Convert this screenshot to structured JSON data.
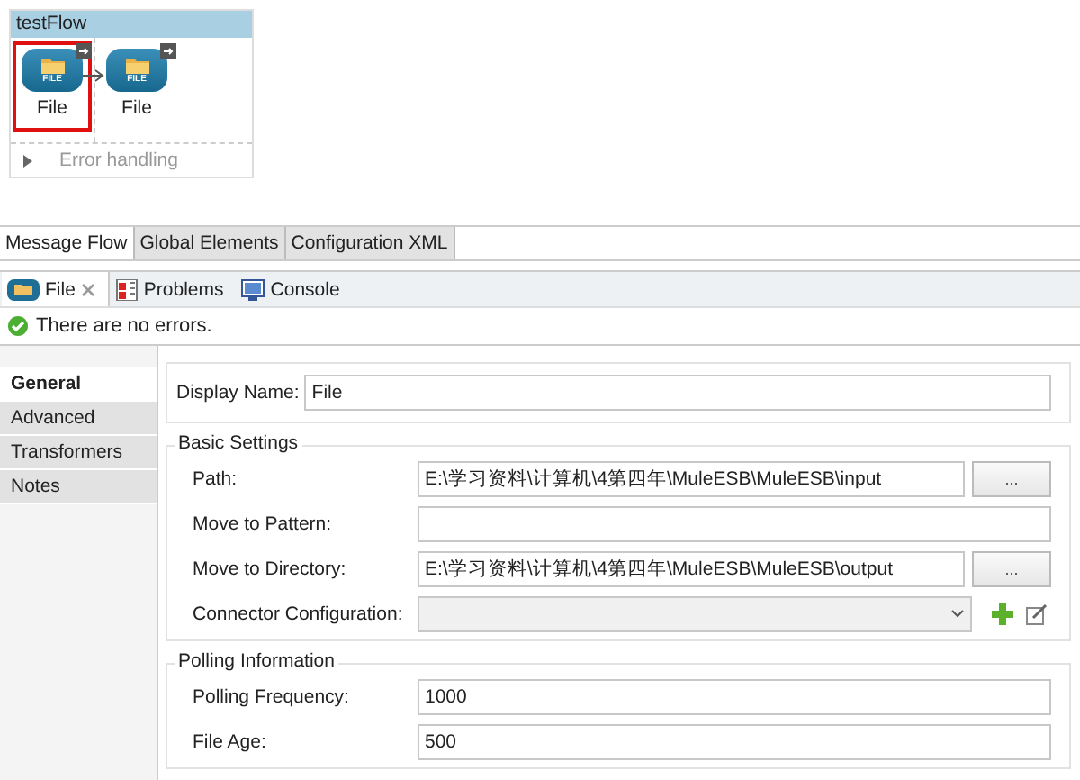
{
  "flow": {
    "title": "testFlow",
    "nodes": [
      {
        "label": "File",
        "badge": "FILE",
        "selected": true
      },
      {
        "label": "File",
        "badge": "FILE",
        "selected": false
      }
    ],
    "error_handling": {
      "label": "Error handling",
      "expanded": false
    }
  },
  "editor_tabs": [
    {
      "label": "Message Flow",
      "selected": true
    },
    {
      "label": "Global Elements",
      "selected": false
    },
    {
      "label": "Configuration XML",
      "selected": false
    }
  ],
  "view_tabs": [
    {
      "label": "File",
      "kind": "file",
      "selected": true,
      "closable": true
    },
    {
      "label": "Problems",
      "kind": "problems",
      "selected": false,
      "closable": false
    },
    {
      "label": "Console",
      "kind": "console",
      "selected": false,
      "closable": false
    }
  ],
  "status": {
    "message": "There are no errors."
  },
  "sidebar": {
    "items": [
      {
        "label": "General",
        "selected": true
      },
      {
        "label": "Advanced",
        "selected": false
      },
      {
        "label": "Transformers",
        "selected": false
      },
      {
        "label": "Notes",
        "selected": false
      }
    ]
  },
  "display_name": {
    "label": "Display Name:",
    "value": "File"
  },
  "groups": [
    {
      "title": "Basic Settings",
      "rows": [
        {
          "kind": "browse",
          "label": "Path:",
          "value": "E:\\学习资料\\计算机\\4第四年\\MuleESB\\MuleESB\\input",
          "button": "..."
        },
        {
          "kind": "text",
          "label": "Move to Pattern:",
          "value": ""
        },
        {
          "kind": "browse",
          "label": "Move to Directory:",
          "value": "E:\\学习资料\\计算机\\4第四年\\MuleESB\\MuleESB\\output",
          "button": "..."
        },
        {
          "kind": "select",
          "label": "Connector Configuration:",
          "value": ""
        }
      ]
    },
    {
      "title": "Polling Information",
      "rows": [
        {
          "kind": "text",
          "label": "Polling Frequency:",
          "value": "1000"
        },
        {
          "kind": "text",
          "label": "File Age:",
          "value": "500"
        }
      ]
    }
  ]
}
